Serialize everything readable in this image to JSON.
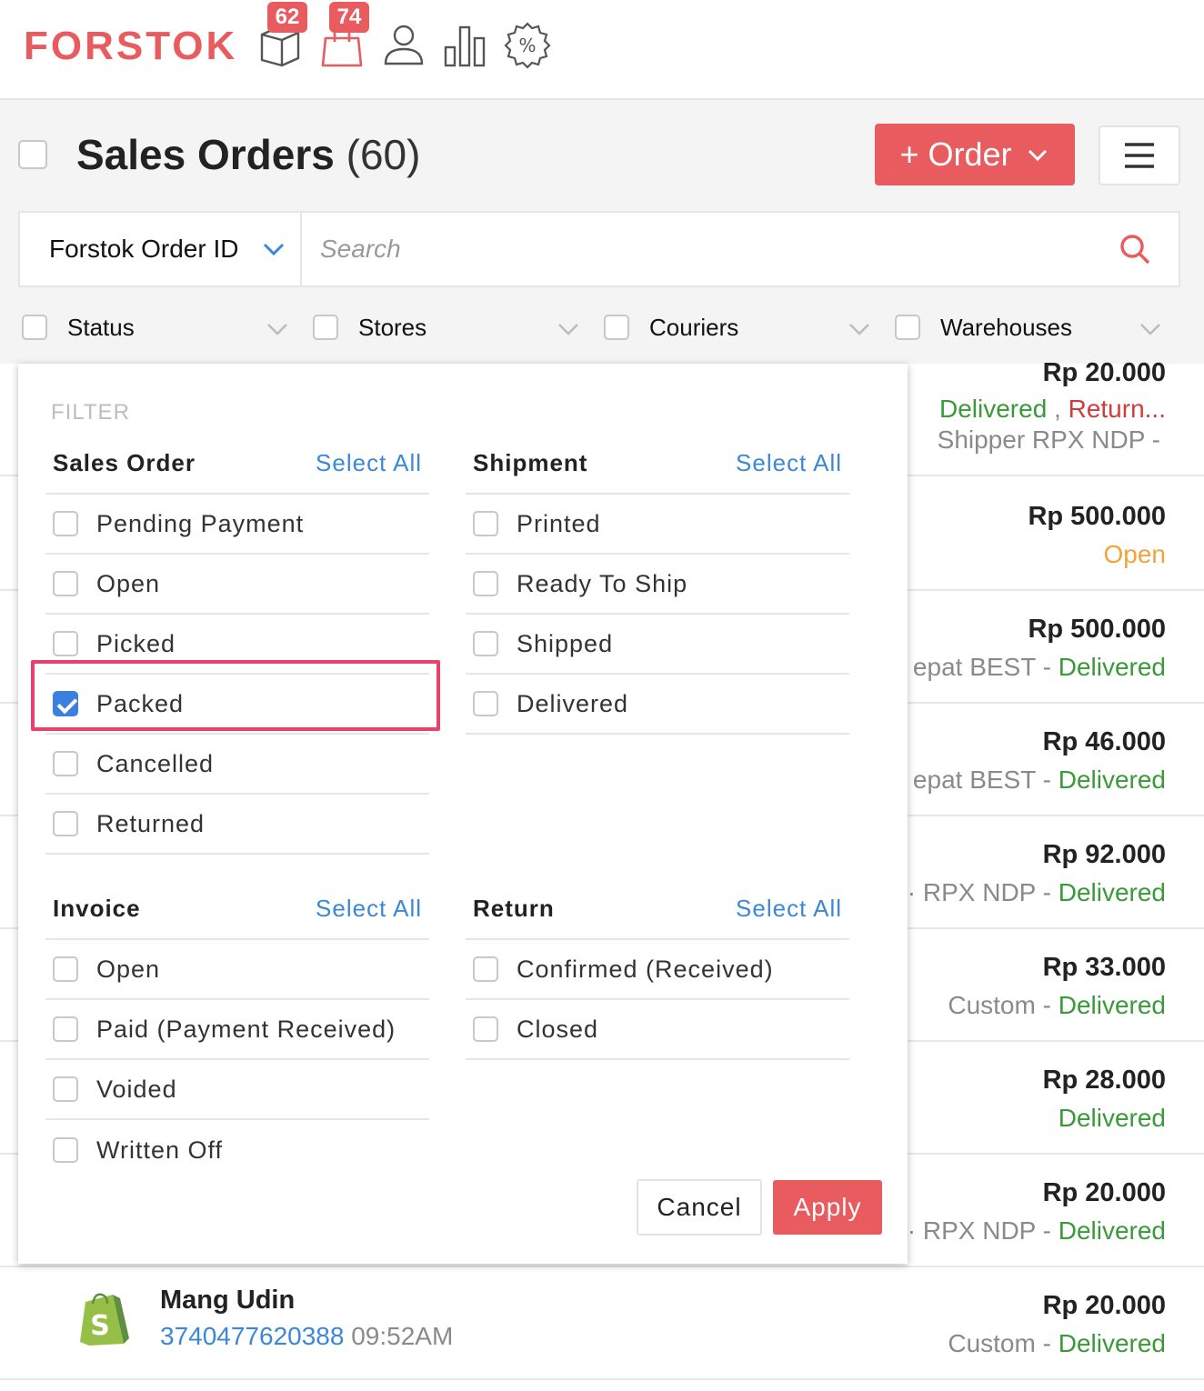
{
  "app": {
    "logo": "FORSTOK",
    "nav": [
      {
        "icon": "box-icon",
        "badge": "62"
      },
      {
        "icon": "shopping-bag-icon",
        "badge": "74"
      },
      {
        "icon": "user-icon",
        "badge": ""
      },
      {
        "icon": "bar-chart-icon",
        "badge": ""
      },
      {
        "icon": "discount-icon",
        "badge": ""
      }
    ]
  },
  "header": {
    "title": "Sales Orders",
    "count": "(60)",
    "order_button": "+ Order"
  },
  "search": {
    "field": "Forstok Order ID",
    "placeholder": "Search"
  },
  "chips": [
    "Status",
    "Stores",
    "Couriers",
    "Warehouses"
  ],
  "orders": [
    {
      "amount": "Rp 20.000",
      "status_a": "Delivered",
      "sep": " , ",
      "status_b": "Return...",
      "line3": "Shipper RPX NDP -"
    },
    {
      "amount": "Rp 500.000",
      "status": "Open"
    },
    {
      "amount": "Rp 500.000",
      "courier": "epat BEST - ",
      "status": "Delivered"
    },
    {
      "amount": "Rp 46.000",
      "courier": "epat BEST - ",
      "status": "Delivered"
    },
    {
      "amount": "Rp 92.000",
      "courier": "· RPX NDP - ",
      "status": "Delivered"
    },
    {
      "amount": "Rp 33.000",
      "courier": "Custom - ",
      "status": "Delivered"
    },
    {
      "amount": "Rp 28.000",
      "courier": "",
      "status": "Delivered"
    },
    {
      "amount": "Rp 20.000",
      "courier": "· RPX NDP - ",
      "status": "Delivered"
    },
    {
      "amount": "Rp 20.000",
      "courier": "Custom - ",
      "status": "Delivered",
      "customer": "Mang Udin",
      "order_id": "3740477620388",
      "time": " 09:52AM"
    }
  ],
  "filter": {
    "label": "FILTER",
    "select_all": "Select All",
    "sales_order": {
      "title": "Sales Order",
      "options": [
        "Pending Payment",
        "Open",
        "Picked",
        "Packed",
        "Cancelled",
        "Returned"
      ],
      "checked": "Packed"
    },
    "shipment": {
      "title": "Shipment",
      "options": [
        "Printed",
        "Ready To Ship",
        "Shipped",
        "Delivered"
      ]
    },
    "invoice": {
      "title": "Invoice",
      "options": [
        "Open",
        "Paid (Payment Received)",
        "Voided",
        "Written Off"
      ]
    },
    "return": {
      "title": "Return",
      "options": [
        "Confirmed (Received)",
        "Closed"
      ]
    },
    "cancel": "Cancel",
    "apply": "Apply"
  },
  "colors": {
    "brand": "#e85b5f",
    "link": "#3b88d6",
    "delivered": "#3a9a3a",
    "returned": "#d23b3b",
    "open": "#f3a23a",
    "highlight": "#e8416b"
  }
}
